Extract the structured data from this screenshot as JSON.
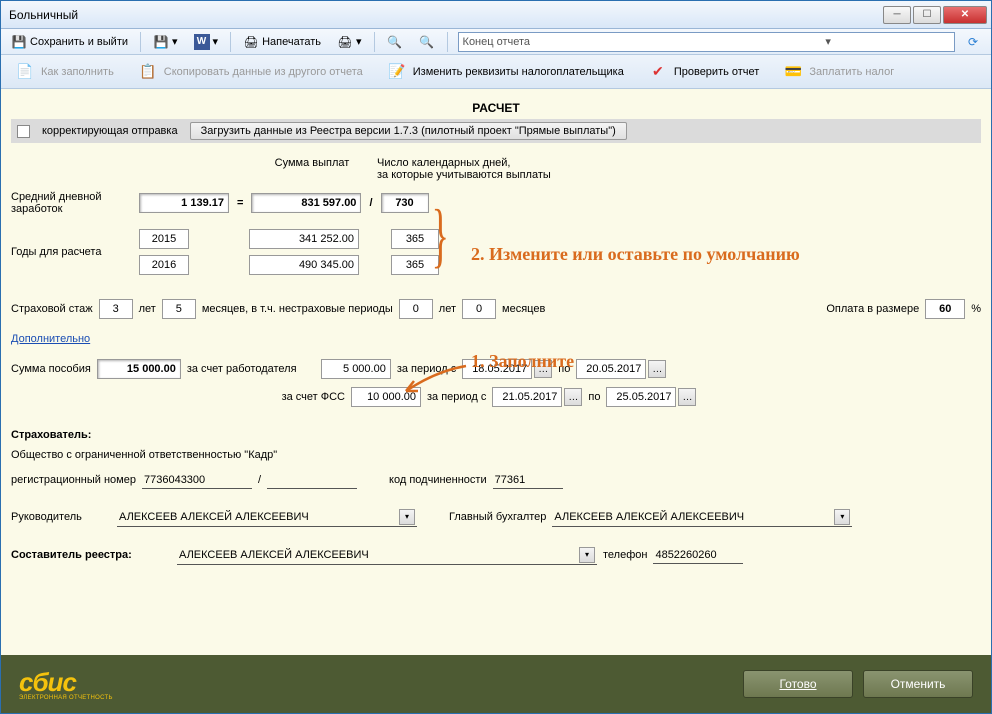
{
  "window": {
    "title": "Больничный"
  },
  "toolbar1": {
    "save_exit": "Сохранить и выйти",
    "print": "Напечатать",
    "combo": "Конец отчета"
  },
  "toolbar2": {
    "how_fill": "Как заполнить",
    "copy_data": "Скопировать данные из другого отчета",
    "change_req": "Изменить реквизиты налогоплательщика",
    "check_report": "Проверить отчет",
    "pay_tax": "Заплатить налог"
  },
  "section": {
    "title": "РАСЧЕТ"
  },
  "correcting": {
    "label": "корректирующая отправка",
    "load_btn": "Загрузить данные из Реестра версии 1.7.3 (пилотный проект \"Прямые выплаты\")"
  },
  "headers": {
    "sum": "Сумма выплат",
    "days": "Число календарных дней,\nза которые учитываются выплаты"
  },
  "avg": {
    "label": "Средний дневной заработок",
    "value": "1 139.17",
    "total_sum": "831 597.00",
    "total_days": "730"
  },
  "years": {
    "label": "Годы для расчета",
    "rows": [
      {
        "year": "2015",
        "sum": "341 252.00",
        "days": "365"
      },
      {
        "year": "2016",
        "sum": "490 345.00",
        "days": "365"
      }
    ]
  },
  "experience": {
    "label": "Страховой стаж",
    "years": "3",
    "years_lbl": "лет",
    "months": "5",
    "months_lbl": "месяцев, в т.ч. нестраховые периоды",
    "ni_years": "0",
    "ni_years_lbl": "лет",
    "ni_months": "0",
    "ni_months_lbl": "месяцев",
    "pay_label": "Оплата в размере",
    "pay_pct": "60",
    "pct": "%"
  },
  "additional": "Дополнительно",
  "benefit": {
    "sum_label": "Сумма пособия",
    "sum": "15 000.00",
    "employer_label": "за счет работодателя",
    "employer": "5 000.00",
    "fss_label": "за счет ФСС",
    "fss": "10 000.00",
    "period_from": "за период с",
    "period_to": "по",
    "emp_from": "18.05.2017",
    "emp_to": "20.05.2017",
    "fss_from": "21.05.2017",
    "fss_to": "25.05.2017"
  },
  "insurer": {
    "title": "Страхователь:",
    "org": "Общество с ограниченной ответственностью \"Кадр\"",
    "reg_label": "регистрационный номер",
    "reg_num": "7736043300",
    "slash": "/",
    "sub_label": "код подчиненности",
    "sub_code": "77361",
    "head_label": "Руководитель",
    "head": "АЛЕКСЕЕВ АЛЕКСЕЙ АЛЕКСЕЕВИЧ",
    "acc_label": "Главный бухгалтер",
    "acc": "АЛЕКСЕЕВ АЛЕКСЕЙ АЛЕКСЕЕВИЧ",
    "comp_label": "Составитель реестра:",
    "comp": "АЛЕКСЕЕВ АЛЕКСЕЙ АЛЕКСЕЕВИЧ",
    "phone_label": "телефон",
    "phone": "4852260260"
  },
  "annotations": {
    "a1": "1. Заполните",
    "a2": "2. Измените или оставьте по умолчанию"
  },
  "logo": {
    "big": "сбис",
    "small": "ЭЛЕКТРОННАЯ ОТЧЕТНОСТЬ"
  },
  "footer": {
    "ok": "Готово",
    "cancel": "Отменить"
  }
}
